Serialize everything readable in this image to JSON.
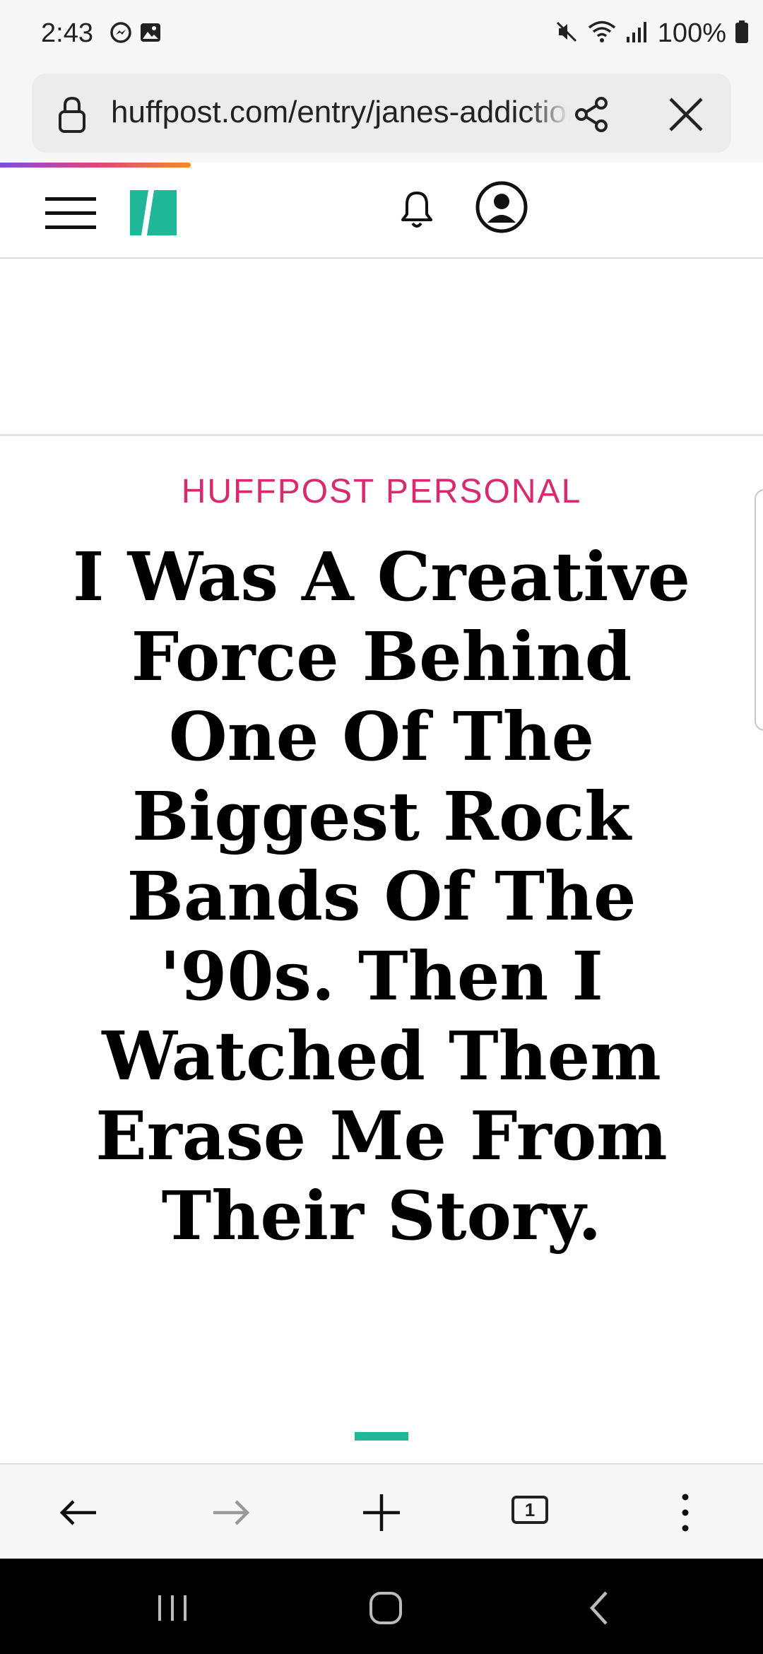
{
  "status_bar": {
    "time": "2:43",
    "battery": "100%",
    "icons": [
      "messenger-icon",
      "gallery-icon",
      "mute-icon",
      "wifi-icon",
      "signal-icon",
      "battery-icon"
    ]
  },
  "browser": {
    "url": "huffpost.com/entry/janes-addiction",
    "tab_count": "1",
    "load_progress": 0.25
  },
  "site": {
    "logo_color": "#1fb798",
    "kicker_color": "#d92a6f"
  },
  "article": {
    "kicker": "HUFFPOST PERSONAL",
    "headline": "I Was A Creative Force Behind One Of The Biggest Rock Bands Of The '90s. Then I Watched Them Erase Me From Their Story."
  }
}
